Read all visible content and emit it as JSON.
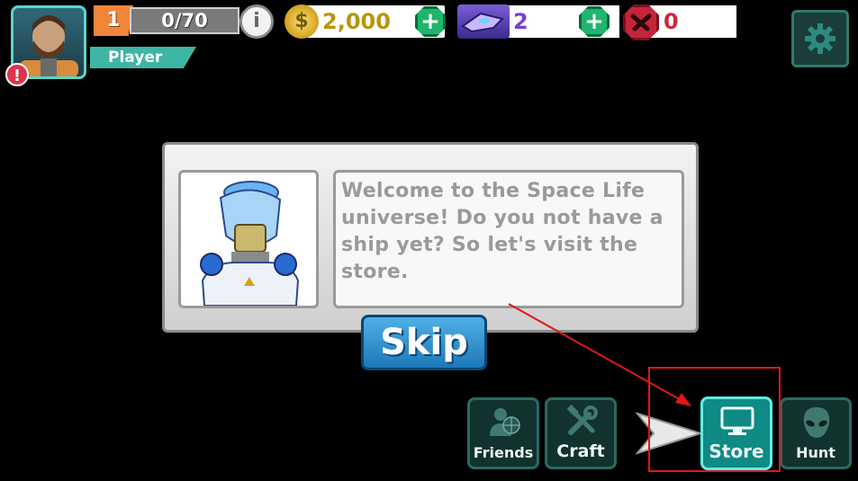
{
  "profile": {
    "name": "Player",
    "level": "1",
    "xp": "0/70",
    "alert": "!",
    "info": "i"
  },
  "resources": {
    "coins": "2,000",
    "ships": "2",
    "hunts": "0",
    "plus": "+",
    "coin_symbol": "$"
  },
  "dialog": {
    "message": "Welcome to the Space Life universe! Do you not have a ship yet? So let's visit the store."
  },
  "skip_label": "Skip",
  "nav": [
    {
      "label": "Friends",
      "icon": "friends-icon"
    },
    {
      "label": "Craft",
      "icon": "tools-icon"
    },
    {
      "label": "Store",
      "icon": "monitor-icon",
      "highlighted": true
    },
    {
      "label": "Hunt",
      "icon": "alien-icon"
    }
  ],
  "colors": {
    "teal": "#3fb5a4",
    "orange": "#f0863a",
    "coin": "#b8960e",
    "ship": "#7a3fd6",
    "hunt": "#d0263a",
    "highlight": "#e01818"
  }
}
